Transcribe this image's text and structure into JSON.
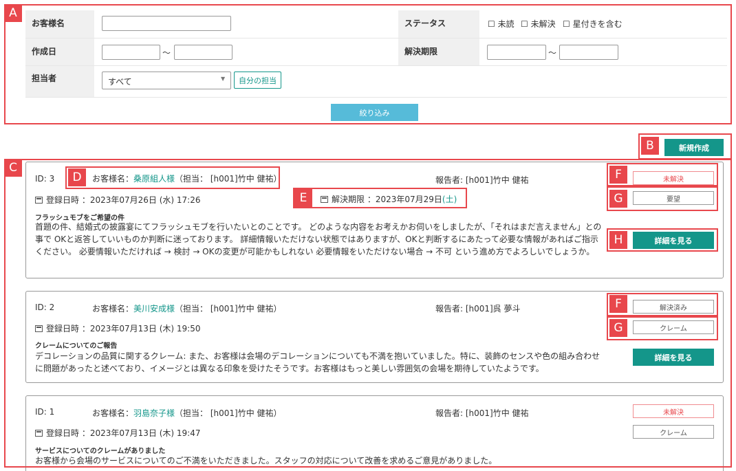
{
  "annotations": {
    "a": "A",
    "b": "B",
    "c": "C",
    "d": "D",
    "e": "E",
    "f": "F",
    "g": "G",
    "h": "H"
  },
  "filter": {
    "customer_label": "お客様名",
    "status_label": "ステータス",
    "status_opts": [
      "未読",
      "未解決",
      "星付きを含む"
    ],
    "created_label": "作成日",
    "due_label": "解決期限",
    "tilde": "〜",
    "assignee_label": "担当者",
    "assignee_value": "すべて",
    "mine_button": "自分の担当",
    "submit": "絞り込み"
  },
  "new_button": "新規作成",
  "common": {
    "customer_prefix": "お客様名：",
    "created_prefix": "登録日時 ：",
    "due_prefix": "解決期限 ：",
    "detail_button": "詳細を見る"
  },
  "cards": [
    {
      "id": "ID: 3",
      "customer": "桑原組人様",
      "assignee": "（担当： [h001]竹中 健祐）",
      "reporter": "報告者: [h001]竹中 健祐",
      "created": "2023年07月26日 (水) 17:26",
      "due_date": "2023年07月29日",
      "due_day": "(土)",
      "status": "未解決",
      "category": "要望",
      "title": "フラッシュモブをご希望の件",
      "body": "首題の件、結婚式の披露宴にてフラッシュモブを行いたいとのことです。 どのような内容をお考えかお伺いをしましたが、「それはまだ言えません」との事で OKと返答していいものか判断に迷っております。 詳細情報いただけない状態ではありますが、OKと判断するにあたって必要な情報があればご指示ください。 必要情報いただければ → 検討 → OKの変更が可能かもしれない 必要情報をいただけない場合 → 不可 という進め方でよろしいでしょうか。"
    },
    {
      "id": "ID: 2",
      "customer": "美川安成様",
      "assignee": "（担当： [h001]竹中 健祐）",
      "reporter": "報告者: [h001]呉 夢斗",
      "created": "2023年07月13日 (木) 19:50",
      "status": "解決済み",
      "category": "クレーム",
      "title": "クレームについてのご報告",
      "body": "デコレーションの品質に関するクレーム: また、お客様は会場のデコレーションについても不満を抱いていました。特に、装飾のセンスや色の組み合わせに問題があったと述べており、イメージとは異なる印象を受けたそうです。お客様はもっと美しい雰囲気の会場を期待していたようです。"
    },
    {
      "id": "ID: 1",
      "customer": "羽島奈子様",
      "assignee": "（担当： [h001]竹中 健祐）",
      "reporter": "報告者: [h001]竹中 健祐",
      "created": "2023年07月13日 (木) 19:47",
      "status": "未解決",
      "category": "クレーム",
      "title": "サービスについてのクレームがありました",
      "body": "お客様から会場のサービスについてのご不満をいただきました。スタッフの対応について改善を求めるご意見がありました。"
    }
  ]
}
